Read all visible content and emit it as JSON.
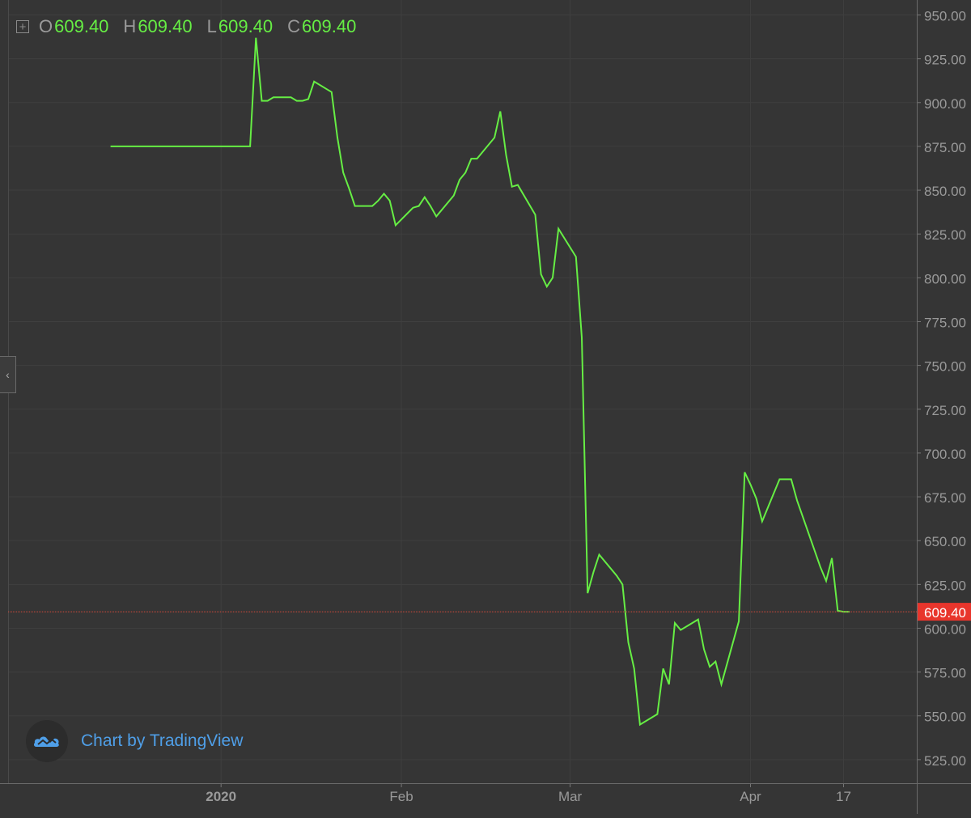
{
  "legend": {
    "o_key": "O",
    "o_val": "609.40",
    "h_key": "H",
    "h_val": "609.40",
    "l_key": "L",
    "l_val": "609.40",
    "c_key": "C",
    "c_val": "609.40"
  },
  "watermark": {
    "text": "Chart by TradingView"
  },
  "colors": {
    "background": "#353535",
    "line": "#66ee44",
    "grid": "#3f3f3f",
    "axis_text": "#9a9a9a",
    "last_price_badge": "#e8352c",
    "last_price_line": "#d24a3a",
    "watermark_text": "#4f9fe8"
  },
  "icons": {
    "legend_toggle": "plus-square-icon",
    "collapse": "chevron-left-icon",
    "logo": "tradingview-cloud-icon"
  },
  "chart_data": {
    "type": "line",
    "title": "",
    "xlabel": "",
    "ylabel": "",
    "ylim": [
      515,
      955
    ],
    "y_ticks": [
      "950.00",
      "925.00",
      "900.00",
      "875.00",
      "850.00",
      "825.00",
      "800.00",
      "775.00",
      "750.00",
      "725.00",
      "700.00",
      "675.00",
      "650.00",
      "625.00",
      "600.00",
      "575.00",
      "550.00",
      "525.00"
    ],
    "x_ticks": [
      {
        "label": "2020",
        "date": "2020-01-01",
        "bold": true
      },
      {
        "label": "Feb",
        "date": "2020-02-01",
        "bold": false
      },
      {
        "label": "Mar",
        "date": "2020-03-01",
        "bold": false
      },
      {
        "label": "Apr",
        "date": "2020-04-01",
        "bold": false
      },
      {
        "label": "17",
        "date": "2020-04-17",
        "bold": false
      }
    ],
    "last_price": 609.4,
    "last_price_label": "609.40",
    "grid": true,
    "series": [
      {
        "values": [
          [
            "2019-12-13",
            875
          ],
          [
            "2019-12-31",
            875
          ],
          [
            "2020-01-06",
            875
          ],
          [
            "2020-01-07",
            937
          ],
          [
            "2020-01-08",
            901
          ],
          [
            "2020-01-09",
            901
          ],
          [
            "2020-01-10",
            903
          ],
          [
            "2020-01-13",
            903
          ],
          [
            "2020-01-14",
            901
          ],
          [
            "2020-01-15",
            901
          ],
          [
            "2020-01-16",
            902
          ],
          [
            "2020-01-17",
            912
          ],
          [
            "2020-01-20",
            906
          ],
          [
            "2020-01-21",
            880
          ],
          [
            "2020-01-22",
            860
          ],
          [
            "2020-01-23",
            851
          ],
          [
            "2020-01-24",
            841
          ],
          [
            "2020-01-27",
            841
          ],
          [
            "2020-01-28",
            844
          ],
          [
            "2020-01-29",
            848
          ],
          [
            "2020-01-30",
            844
          ],
          [
            "2020-01-31",
            830
          ],
          [
            "2020-02-03",
            840
          ],
          [
            "2020-02-04",
            841
          ],
          [
            "2020-02-05",
            846
          ],
          [
            "2020-02-06",
            841
          ],
          [
            "2020-02-07",
            835
          ],
          [
            "2020-02-10",
            847
          ],
          [
            "2020-02-11",
            856
          ],
          [
            "2020-02-12",
            860
          ],
          [
            "2020-02-13",
            868
          ],
          [
            "2020-02-14",
            868
          ],
          [
            "2020-02-17",
            880
          ],
          [
            "2020-02-18",
            895
          ],
          [
            "2020-02-19",
            870
          ],
          [
            "2020-02-20",
            852
          ],
          [
            "2020-02-21",
            853
          ],
          [
            "2020-02-24",
            836
          ],
          [
            "2020-02-25",
            802
          ],
          [
            "2020-02-26",
            795
          ],
          [
            "2020-02-27",
            800
          ],
          [
            "2020-02-28",
            828
          ],
          [
            "2020-03-02",
            812
          ],
          [
            "2020-03-03",
            766
          ],
          [
            "2020-03-04",
            620
          ],
          [
            "2020-03-05",
            632
          ],
          [
            "2020-03-06",
            642
          ],
          [
            "2020-03-09",
            630
          ],
          [
            "2020-03-10",
            625
          ],
          [
            "2020-03-11",
            592
          ],
          [
            "2020-03-12",
            577
          ],
          [
            "2020-03-13",
            545
          ],
          [
            "2020-03-16",
            551
          ],
          [
            "2020-03-17",
            577
          ],
          [
            "2020-03-18",
            568
          ],
          [
            "2020-03-19",
            603
          ],
          [
            "2020-03-20",
            599
          ],
          [
            "2020-03-23",
            605
          ],
          [
            "2020-03-24",
            588
          ],
          [
            "2020-03-25",
            578
          ],
          [
            "2020-03-26",
            581
          ],
          [
            "2020-03-27",
            568
          ],
          [
            "2020-03-30",
            604
          ],
          [
            "2020-03-31",
            689
          ],
          [
            "2020-04-01",
            682
          ],
          [
            "2020-04-02",
            674
          ],
          [
            "2020-04-03",
            661
          ],
          [
            "2020-04-06",
            685
          ],
          [
            "2020-04-07",
            685
          ],
          [
            "2020-04-08",
            685
          ],
          [
            "2020-04-09",
            673
          ],
          [
            "2020-04-13",
            635
          ],
          [
            "2020-04-14",
            627
          ],
          [
            "2020-04-15",
            640
          ],
          [
            "2020-04-16",
            610
          ],
          [
            "2020-04-17",
            609.4
          ],
          [
            "2020-04-18",
            609.4
          ]
        ]
      }
    ]
  }
}
